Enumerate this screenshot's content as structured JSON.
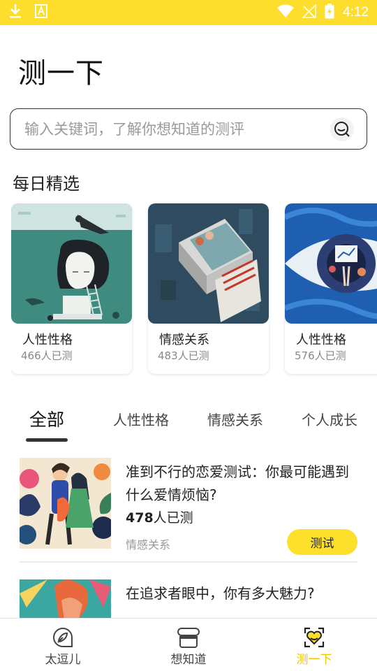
{
  "status_bar": {
    "time": "4:12"
  },
  "page": {
    "title": "测一下"
  },
  "search": {
    "placeholder": "输入关键词，了解你想知道的测评"
  },
  "daily": {
    "title": "每日精选",
    "cards": [
      {
        "title": "人性性格",
        "count": "466人已测"
      },
      {
        "title": "情感关系",
        "count": "483人已测"
      },
      {
        "title": "人性性格",
        "count": "576人已测"
      }
    ]
  },
  "tabs": [
    {
      "label": "全部",
      "active": true
    },
    {
      "label": "人性性格",
      "active": false
    },
    {
      "label": "情感关系",
      "active": false
    },
    {
      "label": "个人成长",
      "active": false
    }
  ],
  "list": [
    {
      "title": "准到不行的恋爱测试：你最可能遇到什么爱情烦恼?",
      "count_number": "478",
      "count_suffix": "人已测",
      "category": "情感关系",
      "button": "测试"
    },
    {
      "title": "在追求者眼中，你有多大魅力?"
    }
  ],
  "bottom_nav": [
    {
      "label": "太逗儿",
      "icon": "chat-leaf-icon",
      "active": false
    },
    {
      "label": "想知道",
      "icon": "stack-icon",
      "active": false
    },
    {
      "label": "测一下",
      "icon": "heart-scan-icon",
      "active": true
    }
  ],
  "colors": {
    "accent": "#fde02b",
    "status_bar": "#fdde2c",
    "active_nav": "#f4c400"
  }
}
